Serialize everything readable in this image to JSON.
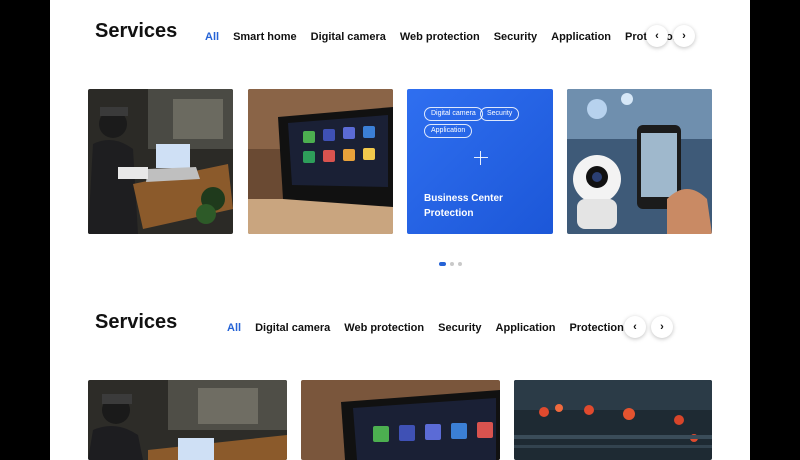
{
  "section1": {
    "title": "Services",
    "tabs": [
      "All",
      "Smart home",
      "Digital camera",
      "Web protection",
      "Security",
      "Application",
      "Protection"
    ],
    "active_tab": "All",
    "prev": "‹",
    "next": "›",
    "cards": {
      "blue": {
        "chips": [
          "Digital camera",
          "Security",
          "Application"
        ],
        "title": "Business Center Protection"
      }
    }
  },
  "section2": {
    "title": "Services",
    "tabs": [
      "All",
      "Digital camera",
      "Web protection",
      "Security",
      "Application",
      "Protection"
    ],
    "active_tab": "All",
    "prev": "‹",
    "next": "›"
  },
  "colors": {
    "accent": "#2563d6",
    "card_blue": "#2a66e8"
  }
}
